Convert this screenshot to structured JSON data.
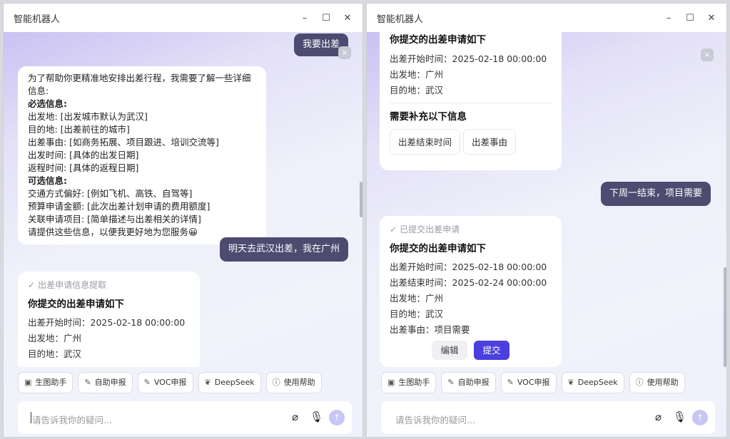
{
  "left": {
    "window_title": "智能机器人",
    "controls": {
      "minimize": "–",
      "maximize": "☐",
      "close": "✕"
    },
    "msg_user_1": "我要出差",
    "msg_bot_1": {
      "intro": "为了帮助你更精准地安排出差行程，我需要了解一些详细信息:",
      "required_header": "必选信息:",
      "required": [
        "出发地: [出发城市默认为武汉]",
        "目的地: [出差前往的城市]",
        "出差事由: [如商务拓展、项目跟进、培训交流等]",
        "出发时间: [具体的出发日期]",
        "返程时间: [具体的返程日期]"
      ],
      "optional_header": "可选信息:",
      "optional": [
        "交通方式偏好: [例如飞机、高铁、自驾等]",
        "预算申请金额: [此次出差计划申请的费用额度]",
        "关联申请项目: [简单描述与出差相关的详情]"
      ],
      "closing": "请提供这些信息，以便我更好地为您服务😀"
    },
    "msg_user_2": "明天去武汉出差，我在广州",
    "msg_bot_2": {
      "status": "出差申请信息提取",
      "title": "你提交的出差申请如下",
      "lines": [
        "出差开始时间：2025-02-18 00:00:00",
        "出发地：广州",
        "目的地：武汉"
      ]
    },
    "close_x": "×",
    "input_placeholder": "请告诉我你的疑问..."
  },
  "right": {
    "window_title": "智能机器人",
    "controls": {
      "minimize": "–",
      "maximize": "☐",
      "close": "✕"
    },
    "card_1": {
      "title": "你提交的出差申请如下",
      "lines": [
        "出差开始时间：2025-02-18 00:00:00",
        "出发地：广州",
        "目的地：武汉"
      ],
      "supplement_title": "需要补充以下信息",
      "chips": [
        "出差结束时间",
        "出差事由"
      ]
    },
    "msg_user": "下周一结束，项目需要",
    "card_2": {
      "status": "已提交出差申请",
      "title": "你提交的出差申请如下",
      "lines": [
        "出差开始时间：2025-02-18 00:00:00",
        "出差结束时间：2025-02-24 00:00:00",
        "出发地：广州",
        "目的地：武汉",
        "出差事由：项目需要"
      ],
      "edit_label": "编辑",
      "submit_label": "提交"
    },
    "close_x": "×",
    "input_placeholder": "请告诉我你的疑问..."
  },
  "quick_actions": [
    {
      "label": "生图助手",
      "icon": "image-icon"
    },
    {
      "label": "自助申报",
      "icon": "edit-icon"
    },
    {
      "label": "VOC申报",
      "icon": "edit-icon"
    },
    {
      "label": "DeepSeek",
      "icon": "whale-icon"
    },
    {
      "label": "使用帮助",
      "icon": "info-icon"
    }
  ],
  "colors": {
    "user_bubble": "#4d4b70",
    "submit": "#4b3fe0",
    "send": "#c7c6f5"
  }
}
